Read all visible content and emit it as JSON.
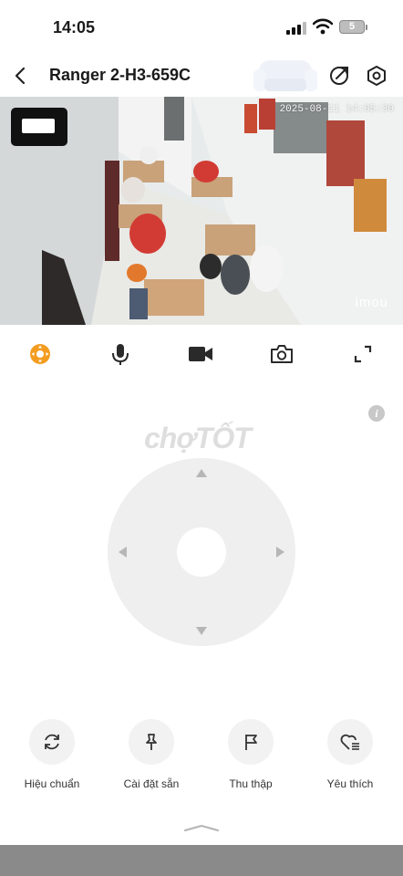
{
  "status_bar": {
    "time": "14:05",
    "battery": "5"
  },
  "nav": {
    "title": "Ranger 2-H3-659C",
    "icons": [
      "back-icon",
      "share-icon",
      "settings-icon"
    ]
  },
  "camera": {
    "timestamp": "2025-08-11 14:05:30",
    "brand": "imou"
  },
  "toolbar": {
    "items": [
      "ptz-control-icon",
      "microphone-icon",
      "video-record-icon",
      "snapshot-icon",
      "fullscreen-icon"
    ],
    "active_color": "#f39c1f"
  },
  "ptz": {
    "watermark": "chợTỐT",
    "info": "i"
  },
  "actions": [
    {
      "label": "Hiệu chuẩn",
      "icon": "calibrate-icon"
    },
    {
      "label": "Cài đặt sẵn",
      "icon": "pin-icon"
    },
    {
      "label": "Thu thập",
      "icon": "flag-icon"
    },
    {
      "label": "Yêu thích",
      "icon": "heart-list-icon"
    }
  ]
}
